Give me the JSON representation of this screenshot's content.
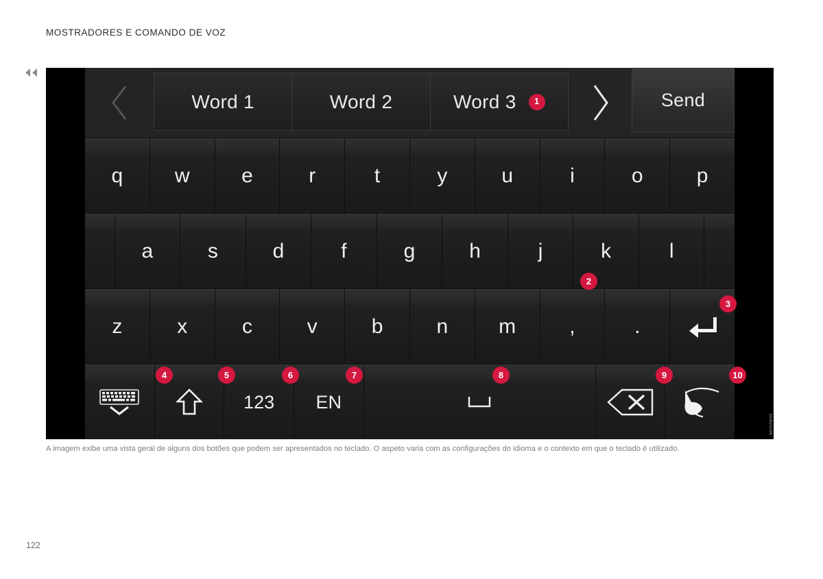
{
  "header": {
    "title": "MOSTRADORES E COMANDO DE VOZ",
    "back_icon": "double-chevron-left-icon"
  },
  "suggestion_bar": {
    "prev_icon": "chevron-left-icon",
    "next_icon": "chevron-right-icon",
    "words": [
      "Word 1",
      "Word 2",
      "Word 3"
    ],
    "word3_badge": "1",
    "send_label": "Send"
  },
  "keyboard": {
    "row1": [
      "q",
      "w",
      "e",
      "r",
      "t",
      "y",
      "u",
      "i",
      "o",
      "p"
    ],
    "row2": [
      "a",
      "s",
      "d",
      "f",
      "g",
      "h",
      "j",
      "k",
      "l"
    ],
    "row3": [
      "z",
      "x",
      "c",
      "v",
      "b",
      "n",
      "m",
      ",",
      "."
    ],
    "enter_icon": "enter-return-icon",
    "function_row": [
      {
        "id": "hide-keyboard",
        "label": "",
        "icon": "hide-keyboard-icon"
      },
      {
        "id": "shift",
        "label": "",
        "icon": "shift-arrow-up-icon"
      },
      {
        "id": "numeric",
        "label": "123",
        "icon": ""
      },
      {
        "id": "language",
        "label": "EN",
        "icon": ""
      },
      {
        "id": "space",
        "label": "",
        "icon": "space-bar-icon"
      },
      {
        "id": "backspace",
        "label": "",
        "icon": "backspace-delete-icon"
      },
      {
        "id": "handwriting",
        "label": "",
        "icon": "handwriting-pen-icon"
      }
    ]
  },
  "callouts": {
    "b2": "2",
    "b3": "3",
    "b4": "4",
    "b5": "5",
    "b6": "6",
    "b7": "7",
    "b8": "8",
    "b9": "9",
    "b10": "10"
  },
  "watermark": "G0820296",
  "caption": "A imagem exibe uma vista geral de alguns dos botões que podem ser apresentados no teclado. O aspeto varia com as configurações do idioma e o contexto em que o teclado é utilizado.",
  "page_number": "122"
}
